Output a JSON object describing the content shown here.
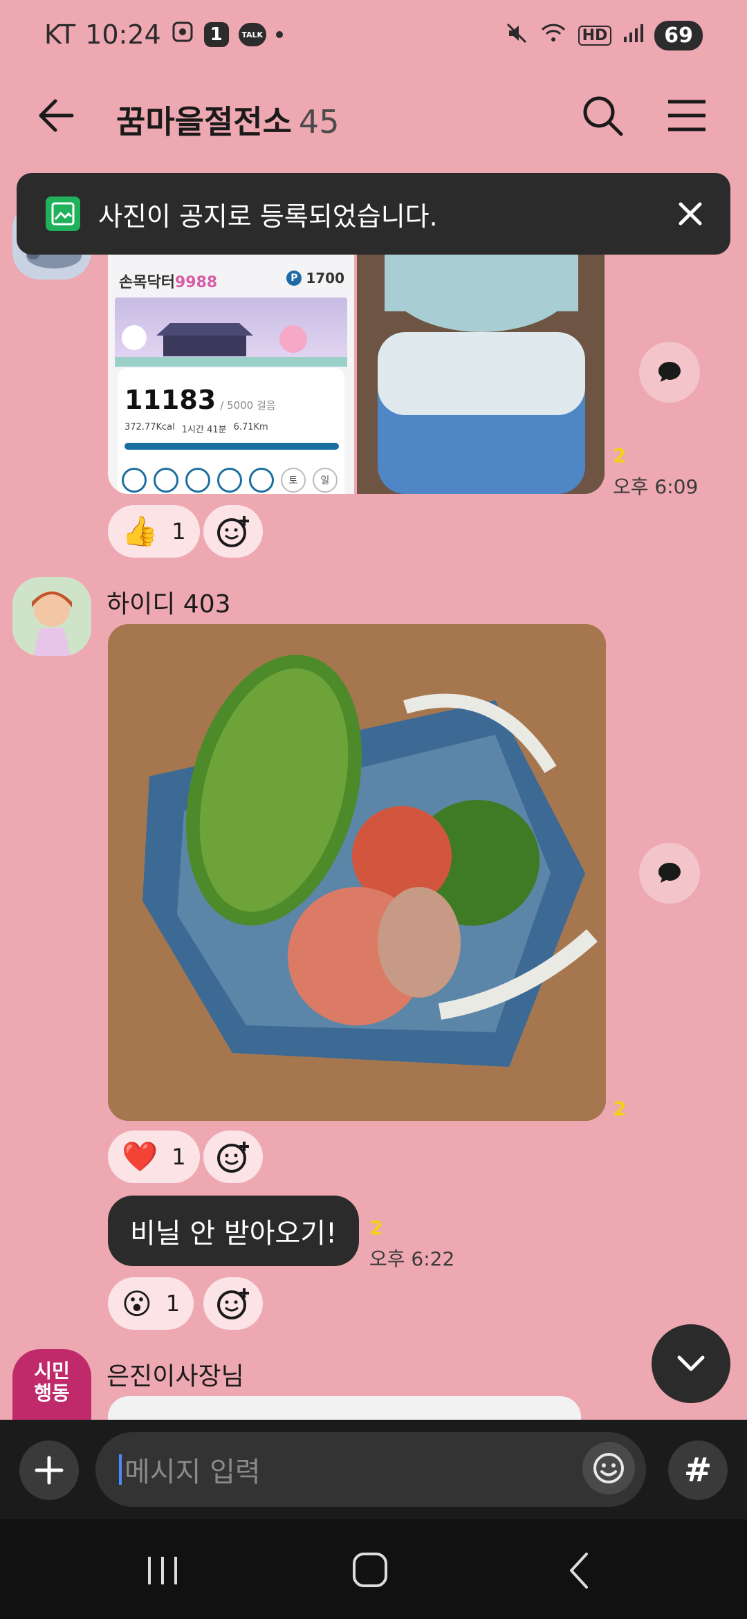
{
  "status_bar": {
    "carrier": "KT",
    "time": "10:24",
    "notification_count": "1",
    "talk_label": "TALK",
    "hd_label": "HD",
    "battery": "69"
  },
  "header": {
    "title": "꿈마을절전소",
    "member_count": "45"
  },
  "toast": {
    "text": "사진이 공지로 등록되었습니다."
  },
  "messages": [
    {
      "read_count": "2",
      "time": "오후 6:09",
      "reaction_emoji": "👍",
      "reaction_count": "1",
      "step_card": {
        "app_name": "손목닥터",
        "app_suffix": "9988",
        "points_label": "P",
        "points": "1700",
        "steps": "11183",
        "goal": "/ 5000 걸음",
        "kcal": "372.77Kcal",
        "duration": "1시간 41분",
        "distance": "6.71Km",
        "day_sat": "토",
        "day_sun": "일"
      }
    },
    {
      "sender": "하이디 403",
      "read_count": "2",
      "reaction_emoji": "❤️",
      "reaction_count": "1"
    },
    {
      "text": "비닐 안 받아오기!",
      "read_count": "2",
      "time": "오후 6:22",
      "reaction_emoji": "😮",
      "reaction_count": "1"
    },
    {
      "sender": "은진이사장님",
      "avatar_line1": "시민",
      "avatar_line2": "행동"
    }
  ],
  "composer": {
    "placeholder": "메시지 입력",
    "hash_label": "#"
  },
  "colors": {
    "background": "#eea8b1",
    "dark": "#2b2b2b",
    "read_count": "#f5d019",
    "toast_icon": "#1fb25a"
  }
}
